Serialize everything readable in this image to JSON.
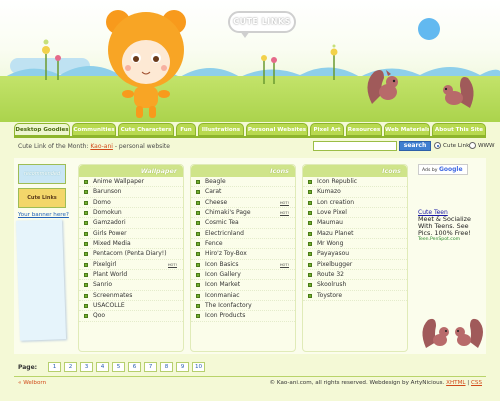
{
  "header": {
    "logo_text": "CUTE LINKS"
  },
  "tabs": [
    {
      "label": "Desktop Goodies",
      "active": true
    },
    {
      "label": "Communities",
      "active": false
    },
    {
      "label": "Cute Characters",
      "active": false
    },
    {
      "label": "Fun",
      "active": false
    },
    {
      "label": "Illustrations",
      "active": false
    },
    {
      "label": "Personal Websites",
      "active": false
    },
    {
      "label": "Pixel Art",
      "active": false
    },
    {
      "label": "Resources",
      "active": false
    },
    {
      "label": "Web Materials",
      "active": false
    },
    {
      "label": "About This Site",
      "active": false
    }
  ],
  "infobar": {
    "month_prefix": "Cute Link of the Month: ",
    "month_link": "Kao-ani",
    "month_suffix": " - personal website",
    "search_value": "",
    "search_button": "search",
    "radio_cute": "Cute Links",
    "radio_www": "WWW"
  },
  "left_panel": {
    "badge_top": "recommended",
    "badge_bottom": "Cute Links",
    "link": "Your banner here?"
  },
  "columns": [
    {
      "header": "Wallpaper",
      "items": [
        {
          "label": "Anime Wallpaper",
          "hot": ""
        },
        {
          "label": "Barunson",
          "hot": ""
        },
        {
          "label": "Domo",
          "hot": ""
        },
        {
          "label": "Domokun",
          "hot": ""
        },
        {
          "label": "Gamzadori",
          "hot": ""
        },
        {
          "label": "Girls Power",
          "hot": ""
        },
        {
          "label": "Mixed Media",
          "hot": ""
        },
        {
          "label": "Pentacom (Penta Diary!)",
          "hot": ""
        },
        {
          "label": "Pixelgirl",
          "hot": "HOT!"
        },
        {
          "label": "Plant World",
          "hot": ""
        },
        {
          "label": "Sanrio",
          "hot": ""
        },
        {
          "label": "Screenmates",
          "hot": ""
        },
        {
          "label": "USACOLLE",
          "hot": ""
        },
        {
          "label": "Qoo",
          "hot": ""
        }
      ]
    },
    {
      "header": "Icons",
      "items": [
        {
          "label": "Beagle",
          "hot": ""
        },
        {
          "label": "Carat",
          "hot": ""
        },
        {
          "label": "Cheese",
          "hot": "HOT!"
        },
        {
          "label": "Chimaki's Page",
          "hot": "HOT!"
        },
        {
          "label": "Cosmic Tea",
          "hot": ""
        },
        {
          "label": "Electricnland",
          "hot": ""
        },
        {
          "label": "Fence",
          "hot": ""
        },
        {
          "label": "Hiro'z Toy-Box",
          "hot": ""
        },
        {
          "label": "Icon Basics",
          "hot": "HOT!"
        },
        {
          "label": "Icon Gallery",
          "hot": ""
        },
        {
          "label": "Icon Market",
          "hot": ""
        },
        {
          "label": "Iconmaniac",
          "hot": ""
        },
        {
          "label": "The Iconfactory",
          "hot": ""
        },
        {
          "label": "Icon Products",
          "hot": ""
        }
      ]
    },
    {
      "header": "Icons",
      "items": [
        {
          "label": "Icon Republic",
          "hot": ""
        },
        {
          "label": "Kumazo",
          "hot": ""
        },
        {
          "label": "Lon creation",
          "hot": ""
        },
        {
          "label": "Love Pixel",
          "hot": ""
        },
        {
          "label": "Maumau",
          "hot": ""
        },
        {
          "label": "Mazu Planet",
          "hot": ""
        },
        {
          "label": "Mr Wong",
          "hot": ""
        },
        {
          "label": "Payayasou",
          "hot": ""
        },
        {
          "label": "Pixelbugger",
          "hot": ""
        },
        {
          "label": "Route 32",
          "hot": ""
        },
        {
          "label": "Skoolrush",
          "hot": ""
        },
        {
          "label": "Toystore",
          "hot": ""
        }
      ]
    }
  ],
  "ads": {
    "ads_by": "Ads by",
    "google": "Google",
    "title": "Cute Teen",
    "line1": "Meet & Socialize",
    "line2": "With Teens. See",
    "line3": "Pics. 100% Free!",
    "url": "Teen.PenSpot.com"
  },
  "pager": {
    "label": "Page:",
    "pages": [
      "1",
      "2",
      "3",
      "4",
      "5",
      "6",
      "7",
      "8",
      "9",
      "10"
    ]
  },
  "footer": {
    "left": "« Welborn",
    "right_text": "© Kao-ani.com, all rights reserved. Webdesign by ArtyNicious.",
    "right_link1": "XHTML",
    "right_sep": " | ",
    "right_link2": "CSS"
  },
  "colors": {
    "ground": "#a9d24a",
    "tab": "#b8d94f",
    "accent_link": "#d14a1a",
    "search_button": "#3f7fd0"
  }
}
